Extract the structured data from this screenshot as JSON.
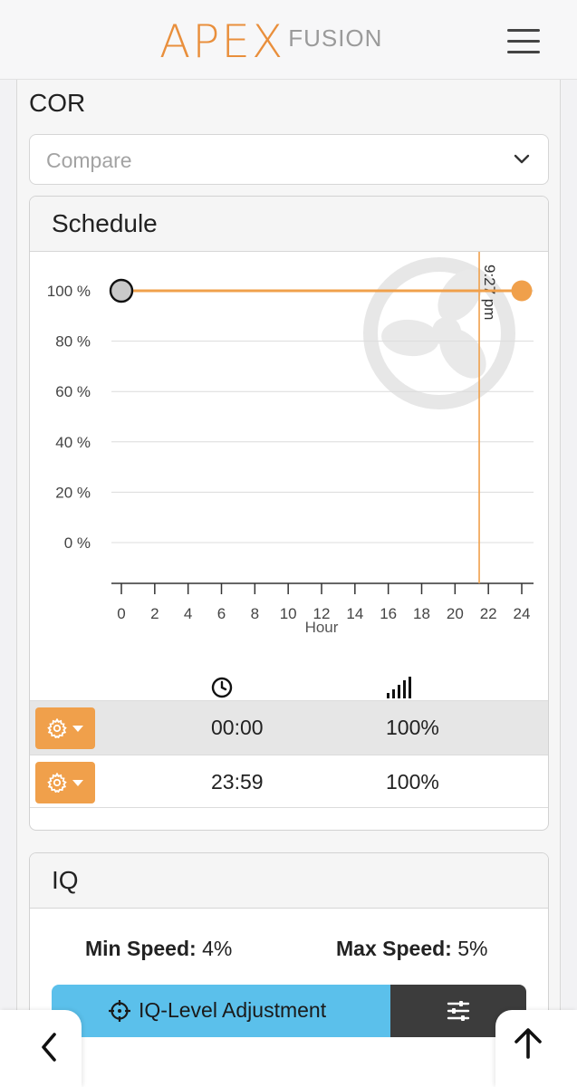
{
  "header": {
    "logo_main": "APEX",
    "logo_sub": "FUSION"
  },
  "cor": {
    "title": "COR",
    "compare_placeholder": "Compare"
  },
  "schedule": {
    "title": "Schedule",
    "column_icons": [
      "clock-icon",
      "signal-strength-icon"
    ],
    "rows": [
      {
        "time": "00:00",
        "speed": "100%"
      },
      {
        "time": "23:59",
        "speed": "100%"
      }
    ]
  },
  "iq": {
    "title": "IQ",
    "min_speed_label": "Min Speed:",
    "min_speed_value": "4%",
    "max_speed_label": "Max Speed:",
    "max_speed_value": "5%",
    "adjust_label": "IQ-Level Adjustment"
  },
  "colors": {
    "accent": "#e98f3c",
    "line": "#f0a04b",
    "iq_button": "#5bc0eb",
    "dark_button": "#3c3c3c"
  },
  "chart_data": {
    "type": "line",
    "xlabel": "Hour",
    "ylabel": "",
    "x_ticks": [
      0,
      2,
      4,
      6,
      8,
      10,
      12,
      14,
      16,
      18,
      20,
      22,
      24
    ],
    "y_ticks": [
      0,
      20,
      40,
      60,
      80,
      100
    ],
    "y_tick_labels": [
      "0 %",
      "20 %",
      "40 %",
      "60 %",
      "80 %",
      "100 %"
    ],
    "xlim": [
      0,
      24
    ],
    "ylim": [
      0,
      100
    ],
    "grid": true,
    "series": [
      {
        "x": [
          0,
          24
        ],
        "y": [
          100,
          100
        ]
      }
    ],
    "current_time_hour": 21.45,
    "current_time_label": "9:27 pm"
  }
}
